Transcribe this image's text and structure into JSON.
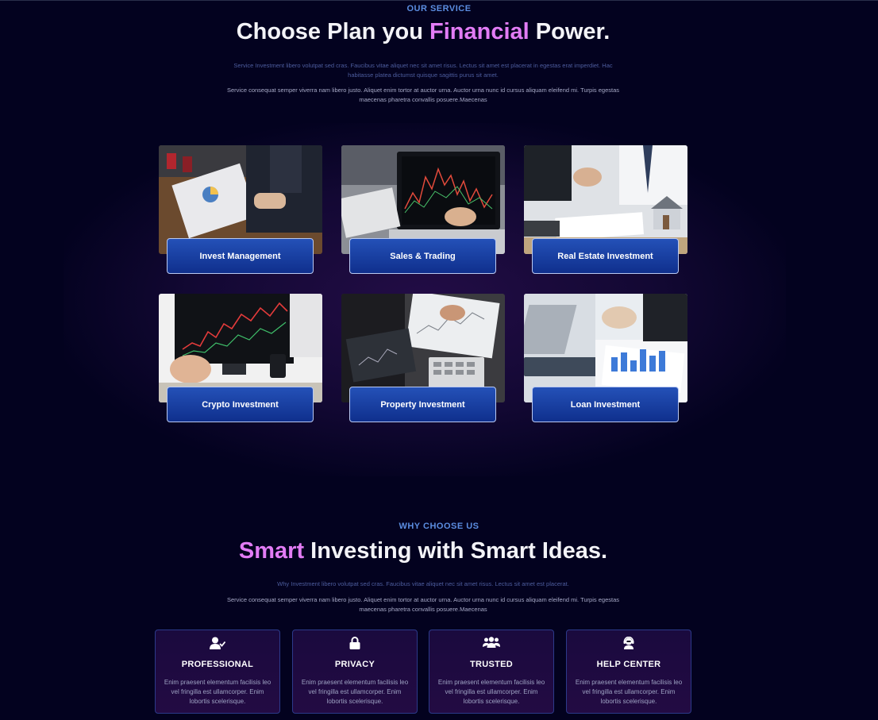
{
  "service": {
    "tag": "OUR SERVICE",
    "title_pre": "Choose Plan you ",
    "title_accent": "Financial",
    "title_post": " Power.",
    "desc_a": "Service Investment libero volutpat sed cras. Faucibus vitae aliquet nec sit amet risus. Lectus sit amet est placerat in egestas erat imperdiet. Hac habitasse platea dictumst quisque sagittis purus sit amet.",
    "desc_b": "Service consequat semper viverra nam libero justo. Aliquet enim tortor at auctor urna. Auctor urna nunc id cursus aliquam eleifend mi. Turpis egestas maecenas pharetra convallis posuere.Maecenas",
    "cards": [
      {
        "label": "Invest Management"
      },
      {
        "label": "Sales & Trading"
      },
      {
        "label": "Real Estate Investment"
      },
      {
        "label": "Crypto Investment"
      },
      {
        "label": "Property Investment"
      },
      {
        "label": "Loan Investment"
      }
    ]
  },
  "why": {
    "tag": "WHY CHOOSE US",
    "title_accent": "Smart",
    "title_post": " Investing with Smart Ideas.",
    "desc_a": "Why Investment libero volutpat sed cras. Faucibus vitae aliquet nec sit amet risus. Lectus sit amet est placerat.",
    "desc_b": "Service consequat semper viverra nam libero justo. Aliquet enim tortor at auctor urna. Auctor urna nunc id cursus aliquam eleifend mi. Turpis egestas maecenas pharetra convallis posuere.Maecenas",
    "features": [
      {
        "icon": "user-check-icon",
        "title": "PROFESSIONAL",
        "text": "Enim praesent elementum facilisis leo vel fringilla est ullamcorper. Enim lobortis scelerisque."
      },
      {
        "icon": "lock-icon",
        "title": "PRIVACY",
        "text": "Enim praesent elementum facilisis leo vel fringilla est ullamcorper. Enim lobortis scelerisque."
      },
      {
        "icon": "users-icon",
        "title": "TRUSTED",
        "text": "Enim praesent elementum facilisis leo vel fringilla est ullamcorper. Enim lobortis scelerisque."
      },
      {
        "icon": "support-agent-icon",
        "title": "HELP CENTER",
        "text": "Enim praesent elementum facilisis leo vel fringilla est ullamcorper. Enim lobortis scelerisque."
      }
    ]
  },
  "colors": {
    "background": "#03021f",
    "accent_pink": "#e27cf5",
    "tag_blue": "#5b8de0",
    "button_blue": "#1a3fa3"
  }
}
